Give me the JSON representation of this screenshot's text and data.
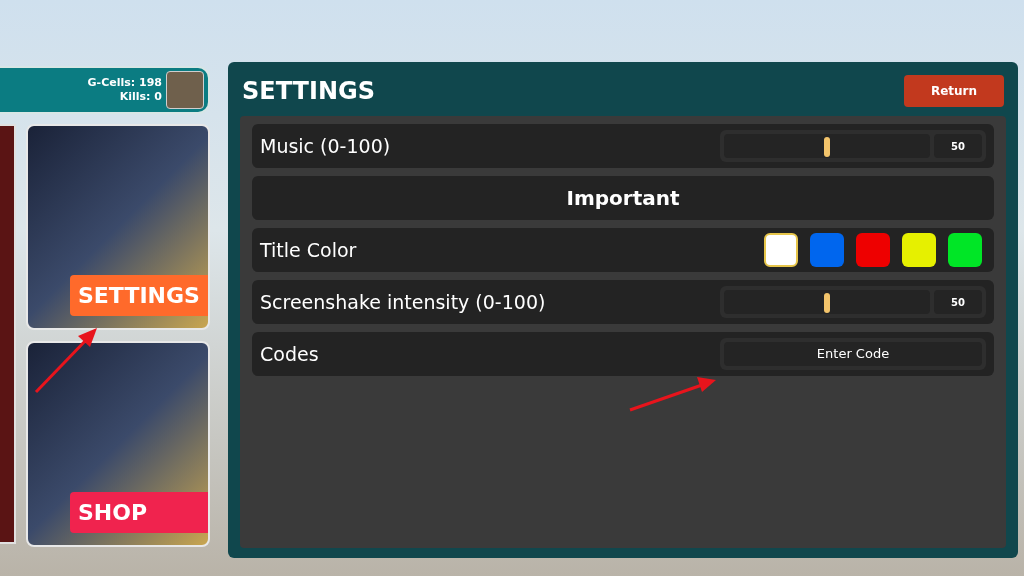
{
  "player_stats": {
    "g_cells": "G-Cells: 198",
    "kills": "Kills: 0"
  },
  "menu_cards": [
    {
      "label": "SETTINGS",
      "color": "#ff6a2b"
    },
    {
      "label": "SHOP",
      "color": "#f0234e"
    }
  ],
  "settings": {
    "title": "SETTINGS",
    "return_button": "Return",
    "rows": [
      {
        "kind": "slider",
        "label": "Music (0-100)",
        "level": 0.5,
        "reading": "50"
      },
      {
        "kind": "header",
        "label": "Important"
      },
      {
        "kind": "swatches",
        "label": "Title Color",
        "swatches": [
          {
            "color": "#ffffff",
            "selected": true
          },
          {
            "color": "#0066ee",
            "selected": false
          },
          {
            "color": "#ee0000",
            "selected": false
          },
          {
            "color": "#e6f000",
            "selected": false
          },
          {
            "color": "#00e626",
            "selected": false
          }
        ]
      },
      {
        "kind": "slider",
        "label": "Screenshake intensity (0-100)",
        "level": 0.5,
        "reading": "50"
      },
      {
        "kind": "button",
        "label": "Codes",
        "button": "Enter Code"
      }
    ]
  }
}
